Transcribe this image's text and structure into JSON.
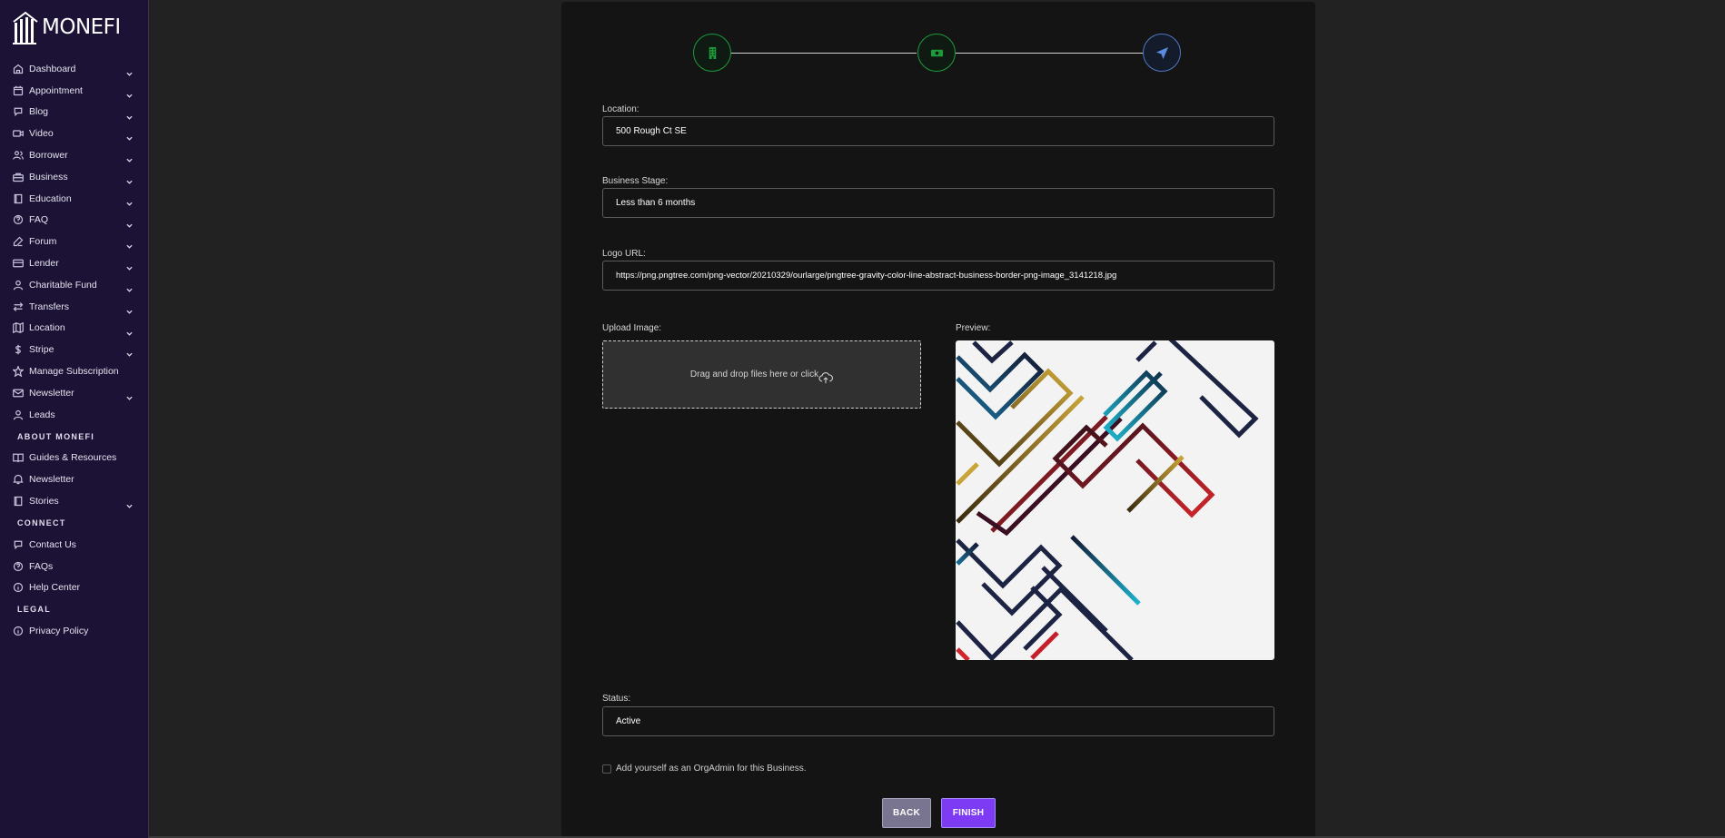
{
  "brand": {
    "name": "MONEFI"
  },
  "sidebar": {
    "items": [
      {
        "label": "Dashboard",
        "icon": "home-icon",
        "chevron": true
      },
      {
        "label": "Appointment",
        "icon": "calendar-icon",
        "chevron": true
      },
      {
        "label": "Blog",
        "icon": "chat-icon",
        "chevron": true
      },
      {
        "label": "Video",
        "icon": "video-icon",
        "chevron": true
      },
      {
        "label": "Borrower",
        "icon": "users-icon",
        "chevron": true
      },
      {
        "label": "Business",
        "icon": "building-icon",
        "chevron": true
      },
      {
        "label": "Education",
        "icon": "book-icon",
        "chevron": true
      },
      {
        "label": "FAQ",
        "icon": "question-icon",
        "chevron": true
      },
      {
        "label": "Forum",
        "icon": "pen-icon",
        "chevron": true
      },
      {
        "label": "Lender",
        "icon": "card-icon",
        "chevron": true
      },
      {
        "label": "Charitable Fund",
        "icon": "user-icon",
        "chevron": true
      },
      {
        "label": "Transfers",
        "icon": "transfer-icon",
        "chevron": true
      },
      {
        "label": "Location",
        "icon": "map-icon",
        "chevron": true
      },
      {
        "label": "Stripe",
        "icon": "dollar-icon",
        "chevron": true
      },
      {
        "label": "Manage Subscription",
        "icon": "star-icon",
        "chevron": false
      },
      {
        "label": "Newsletter",
        "icon": "mail-icon",
        "chevron": true
      },
      {
        "label": "Leads",
        "icon": "user-icon",
        "chevron": false
      }
    ],
    "about_section": "ABOUT MONEFI",
    "about_items": [
      {
        "label": "Guides & Resources",
        "icon": "open-book-icon",
        "chevron": false
      },
      {
        "label": "Newsletter",
        "icon": "bell-icon",
        "chevron": false
      },
      {
        "label": "Stories",
        "icon": "book-icon",
        "chevron": true
      }
    ],
    "connect_section": "CONNECT",
    "connect_items": [
      {
        "label": "Contact Us",
        "icon": "chat-icon",
        "chevron": false
      },
      {
        "label": "FAQs",
        "icon": "question-icon",
        "chevron": false
      },
      {
        "label": "Help Center",
        "icon": "info-icon",
        "chevron": false
      }
    ],
    "legal_section": "LEGAL",
    "legal_items": [
      {
        "label": "Privacy Policy",
        "icon": "info-icon",
        "chevron": false
      }
    ]
  },
  "stepper": {
    "steps": [
      {
        "icon": "building-icon",
        "state": "done"
      },
      {
        "icon": "money-icon",
        "state": "done"
      },
      {
        "icon": "send-icon",
        "state": "active"
      }
    ]
  },
  "form": {
    "location": {
      "label": "Location:",
      "value": "500 Rough Ct SE"
    },
    "business_stage": {
      "label": "Business Stage:",
      "value": "Less than 6 months"
    },
    "logo_url": {
      "label": "Logo URL:",
      "value": "https://png.pngtree.com/png-vector/20210329/ourlarge/pngtree-gravity-color-line-abstract-business-border-png-image_3141218.jpg"
    },
    "upload": {
      "label": "Upload Image:",
      "text": "Drag and drop files here or click"
    },
    "preview": {
      "label": "Preview:"
    },
    "status": {
      "label": "Status:",
      "value": "Active"
    },
    "org_admin_checkbox": {
      "label": "Add yourself as an OrgAdmin for this Business.",
      "checked": false
    }
  },
  "buttons": {
    "back": "BACK",
    "finish": "FINISH"
  },
  "colors": {
    "sidebar_bg": "#1b1235",
    "accent": "#7d3cf4",
    "step_done": "#1f9a3b",
    "step_active": "#4f78c2"
  }
}
